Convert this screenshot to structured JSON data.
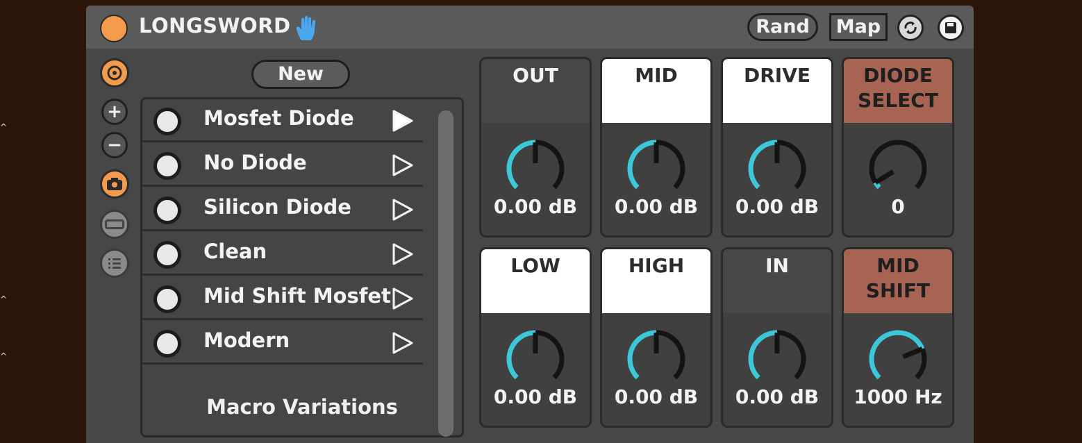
{
  "device": {
    "title": "LONGSWORD",
    "rand_label": "Rand",
    "map_label": "Map"
  },
  "list": {
    "new_label": "New",
    "items": [
      {
        "label": "Mosfet Diode",
        "active": true
      },
      {
        "label": "No Diode",
        "active": false
      },
      {
        "label": "Silicon Diode",
        "active": false
      },
      {
        "label": "Clean",
        "active": false
      },
      {
        "label": "Mid Shift Mosfet",
        "active": false
      },
      {
        "label": "Modern",
        "active": false
      }
    ],
    "footer": "Macro Variations"
  },
  "knobs": [
    {
      "label": "OUT",
      "value": "0.00 dB",
      "header": "dark",
      "level": 0.5
    },
    {
      "label": "MID",
      "value": "0.00 dB",
      "header": "white",
      "level": 0.5
    },
    {
      "label": "DRIVE",
      "value": "0.00 dB",
      "header": "white",
      "level": 0.5
    },
    {
      "label": "DIODE\nSELECT",
      "value": "0",
      "header": "rust",
      "level": 0.05
    },
    {
      "label": "LOW",
      "value": "0.00 dB",
      "header": "white",
      "level": 0.5
    },
    {
      "label": "HIGH",
      "value": "0.00 dB",
      "header": "white",
      "level": 0.5
    },
    {
      "label": "IN",
      "value": "0.00 dB",
      "header": "dark",
      "level": 0.5
    },
    {
      "label": "MID\nSHIFT",
      "value": "1000 Hz",
      "header": "rust",
      "level": 0.75
    }
  ],
  "colors": {
    "accent_orange": "#f39b4c",
    "knob_arc": "#3cc8d8",
    "header_white": "#ffffff",
    "header_rust": "#a86452",
    "background": "#2b1509"
  },
  "icons": {
    "power": "power-dot-icon",
    "hand": "hand-icon",
    "hotswap": "hotswap-icon",
    "save": "save-icon"
  }
}
